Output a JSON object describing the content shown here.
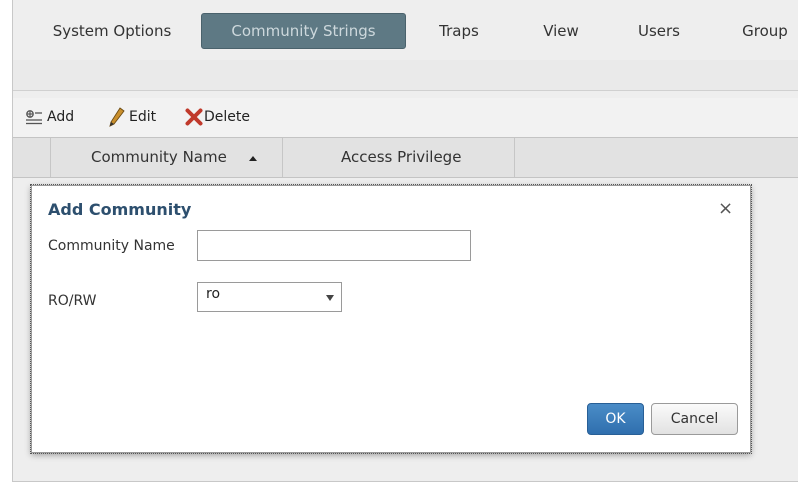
{
  "tabs": [
    {
      "label": "System Options",
      "active": false
    },
    {
      "label": "Community Strings",
      "active": true
    },
    {
      "label": "Traps",
      "active": false
    },
    {
      "label": "View",
      "active": false
    },
    {
      "label": "Users",
      "active": false
    },
    {
      "label": "Group",
      "active": false
    }
  ],
  "toolbar": {
    "add_label": "Add",
    "edit_label": "Edit",
    "delete_label": "Delete"
  },
  "grid": {
    "columns": [
      "Community Name",
      "Access Privilege"
    ],
    "sorted_column": "Community Name",
    "sort_direction": "ascending"
  },
  "dialog": {
    "title": "Add Community",
    "close_glyph": "×",
    "community_name_label": "Community Name",
    "community_name_value": "",
    "rorw_label": "RO/RW",
    "rorw_selected": "ro",
    "ok_label": "OK",
    "cancel_label": "Cancel"
  },
  "colors": {
    "active_tab": "#5e7984",
    "dialog_title": "#2d4f6e",
    "ok_button": "#2f6fae",
    "delete_icon": "#c0392b"
  },
  "icons": {
    "add": "add-list-icon",
    "edit": "pencil-icon",
    "delete": "red-x-icon",
    "sort": "sort-ascending-icon",
    "close": "close-icon",
    "dropdown": "chevron-down-icon"
  }
}
